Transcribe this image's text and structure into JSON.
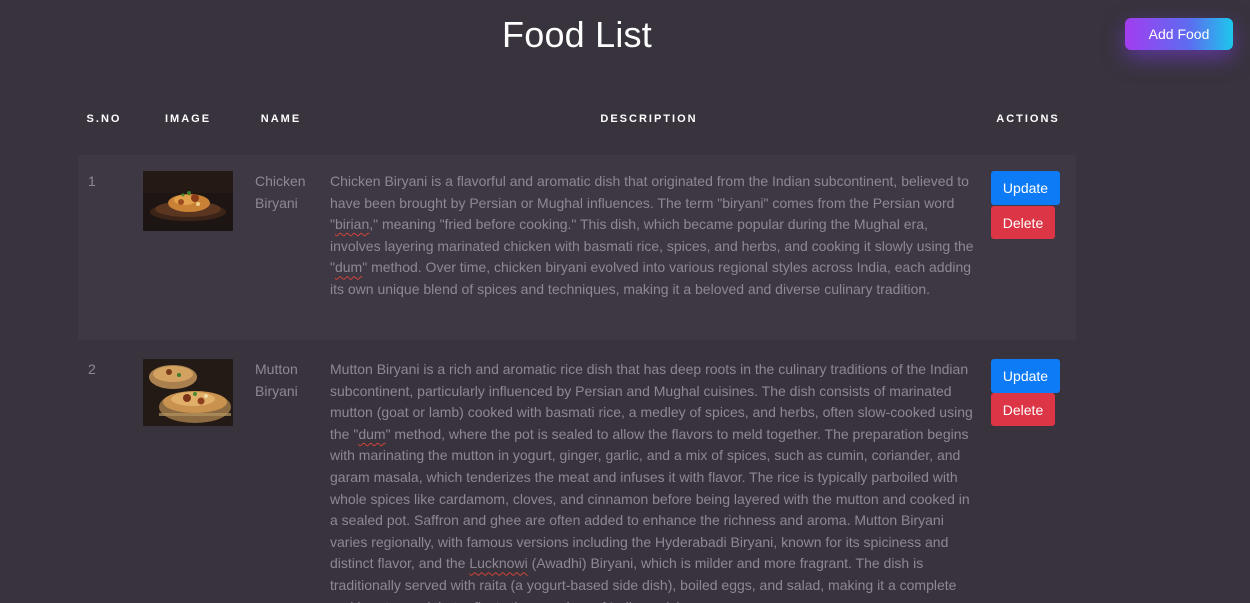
{
  "header": {
    "title": "Food List",
    "add_button": "Add Food"
  },
  "table": {
    "columns": [
      "S.NO",
      "IMAGE",
      "NAME",
      "DESCRIPTION",
      "ACTIONS"
    ],
    "rows": [
      {
        "sno": "1",
        "name": "Chicken Biryani",
        "image_icon": "chicken-biryani-photo",
        "description": "Chicken Biryani is a flavorful and aromatic dish that originated from the Indian subcontinent, believed to have been brought by Persian or Mughal influences. The term \"biryani\" comes from the Persian word \"birian,\" meaning \"fried before cooking.\" This dish, which became popular during the Mughal era, involves layering marinated chicken with basmati rice, spices, and herbs, and cooking it slowly using the \"dum\" method. Over time, chicken biryani evolved into various regional styles across India, each adding its own unique blend of spices and techniques, making it a beloved and diverse culinary tradition.",
        "update_label": "Update",
        "delete_label": "Delete"
      },
      {
        "sno": "2",
        "name": "Mutton Biryani",
        "image_icon": "mutton-biryani-photo",
        "description": "Mutton Biryani is a rich and aromatic rice dish that has deep roots in the culinary traditions of the Indian subcontinent, particularly influenced by Persian and Mughal cuisines. The dish consists of marinated mutton (goat or lamb) cooked with basmati rice, a medley of spices, and herbs, often slow-cooked using the \"dum\" method, where the pot is sealed to allow the flavors to meld together. The preparation begins with marinating the mutton in yogurt, ginger, garlic, and a mix of spices, such as cumin, coriander, and garam masala, which tenderizes the meat and infuses it with flavor. The rice is typically parboiled with whole spices like cardamom, cloves, and cinnamon before being layered with the mutton and cooked in a sealed pot. Saffron and ghee are often added to enhance the richness and aroma. Mutton Biryani varies regionally, with famous versions including the Hyderabadi Biryani, known for its spiciness and distinct flavor, and the Lucknowi (Awadhi) Biryani, which is milder and more fragrant. The dish is traditionally served with raita (a yogurt-based side dish), boiled eggs, and salad, making it a complete and hearty meal that reflects the grandeur of Indian cuisine.",
        "update_label": "Update",
        "delete_label": "Delete"
      }
    ]
  },
  "colors": {
    "background": "#38333d",
    "row_stripe": "#3d3843",
    "update": "#0d7bf6",
    "delete": "#dc3545",
    "gradient_start": "#a23df0",
    "gradient_end": "#1dc7ec",
    "muted_text": "#8e8894"
  }
}
